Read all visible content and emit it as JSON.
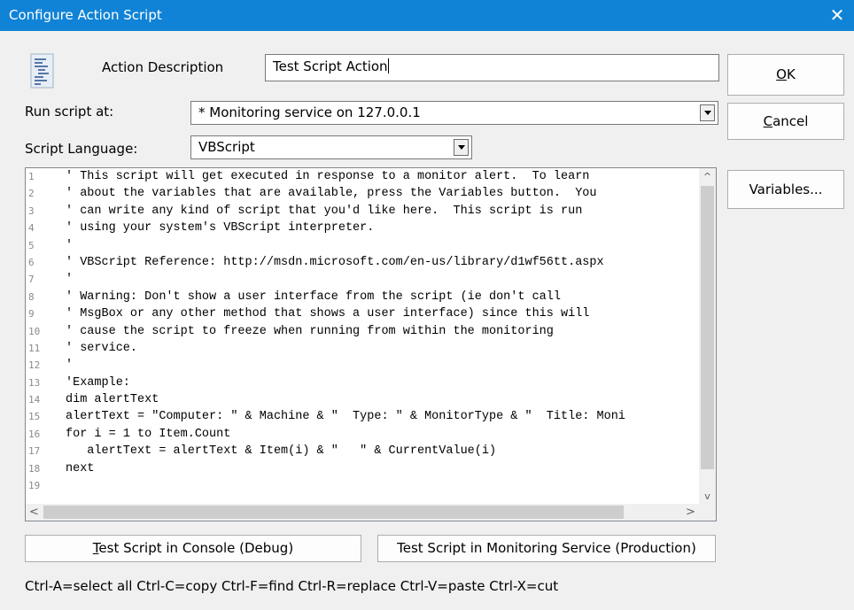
{
  "window": {
    "title": "Configure Action Script",
    "close_glyph": "✕"
  },
  "form": {
    "description_label": "Action Description",
    "description_value": "Test Script Action",
    "run_at_label": "Run script at:",
    "run_at_value": "* Monitoring service on 127.0.0.1",
    "language_label": "Script Language:",
    "language_value": "VBScript"
  },
  "buttons": {
    "ok": {
      "mnemonic": "O",
      "rest": "K"
    },
    "cancel": {
      "mnemonic": "C",
      "rest": "ancel"
    },
    "variables": "Variables...",
    "test_console": {
      "mnemonic": "T",
      "rest": "est Script in Console (Debug)"
    },
    "test_service": "Test Script in Monitoring Service (Production)"
  },
  "editor": {
    "line_numbers": [
      "1",
      "2",
      "3",
      "4",
      "5",
      "6",
      "7",
      "8",
      "9",
      "10",
      "11",
      "12",
      "13",
      "14",
      "15",
      "16",
      "17",
      "18",
      "19"
    ],
    "lines": [
      "' This script will get executed in response to a monitor alert.  To learn",
      "' about the variables that are available, press the Variables button.  You",
      "' can write any kind of script that you'd like here.  This script is run",
      "' using your system's VBScript interpreter.",
      "'",
      "' VBScript Reference: http://msdn.microsoft.com/en-us/library/d1wf56tt.aspx",
      "'",
      "' Warning: Don't show a user interface from the script (ie don't call",
      "' MsgBox or any other method that shows a user interface) since this will",
      "' cause the script to freeze when running from within the monitoring",
      "' service.",
      "'",
      "'Example:",
      "dim alertText",
      "alertText = \"Computer: \" & Machine & \"  Type: \" & MonitorType & \"  Title: Moni",
      "for i = 1 to Item.Count",
      "   alertText = alertText & Item(i) & \"   \" & CurrentValue(i)",
      "next",
      ""
    ],
    "scroll_up": "^",
    "scroll_down": "v",
    "scroll_left": "<",
    "scroll_right": ">"
  },
  "shortcuts": "Ctrl-A=select all  Ctrl-C=copy  Ctrl-F=find  Ctrl-R=replace  Ctrl-V=paste  Ctrl-X=cut",
  "colors": {
    "titlebar": "#1083d6",
    "window_bg": "#f0f0f0"
  }
}
